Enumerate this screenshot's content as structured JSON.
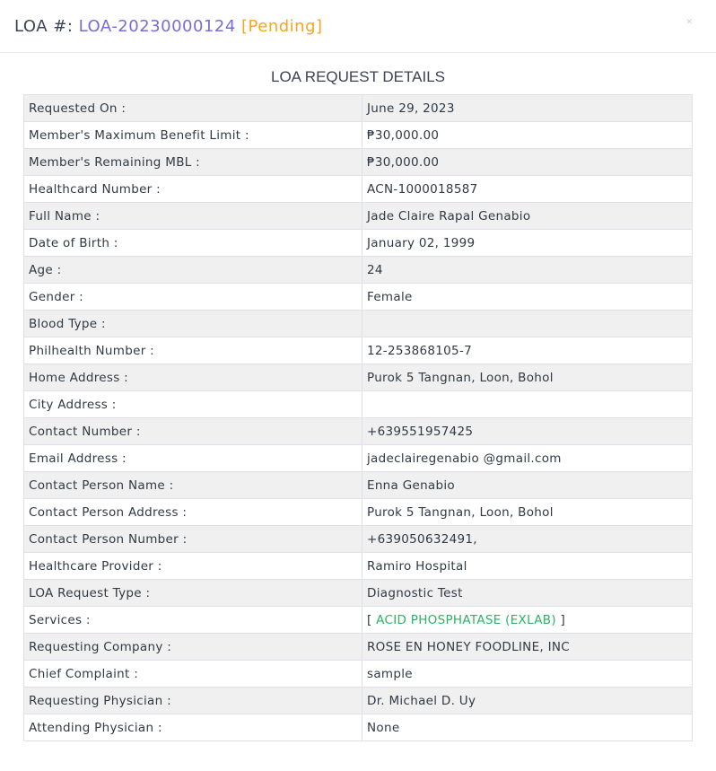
{
  "header": {
    "prefix": "LOA #:",
    "loa_number": "LOA-20230000124",
    "status": "[Pending]"
  },
  "section_title": "LOA REQUEST DETAILS",
  "rows": [
    {
      "label": "Requested On :",
      "value": "June 29, 2023"
    },
    {
      "label": "Member's Maximum Benefit Limit :",
      "value": "₱30,000.00"
    },
    {
      "label": "Member's Remaining MBL :",
      "value": "₱30,000.00"
    },
    {
      "label": "Healthcard Number :",
      "value": "ACN-1000018587"
    },
    {
      "label": "Full Name :",
      "value": "Jade Claire Rapal Genabio"
    },
    {
      "label": "Date of Birth :",
      "value": "January 02, 1999"
    },
    {
      "label": "Age :",
      "value": "24"
    },
    {
      "label": "Gender :",
      "value": "Female"
    },
    {
      "label": "Blood Type :",
      "value": ""
    },
    {
      "label": "Philhealth Number :",
      "value": "12-253868105-7"
    },
    {
      "label": "Home Address :",
      "value": "Purok 5 Tangnan, Loon, Bohol"
    },
    {
      "label": "City Address :",
      "value": ""
    },
    {
      "label": "Contact Number :",
      "value": "+639551957425"
    },
    {
      "label": "Email Address :",
      "value": "jadeclairegenabio @gmail.com"
    },
    {
      "label": "Contact Person Name :",
      "value": "Enna Genabio"
    },
    {
      "label": "Contact Person Address :",
      "value": "Purok 5 Tangnan, Loon, Bohol"
    },
    {
      "label": "Contact Person Number :",
      "value": "+639050632491,"
    },
    {
      "label": "Healthcare Provider :",
      "value": "Ramiro Hospital"
    },
    {
      "label": "LOA Request Type :",
      "value": "Diagnostic Test"
    },
    {
      "label": "Services :",
      "value_prefix": "[ ",
      "service": "ACID PHOSPHATASE (EXLAB)",
      "value_suffix": " ]"
    },
    {
      "label": "Requesting Company :",
      "value": "ROSE EN HONEY FOODLINE, INC"
    },
    {
      "label": "Chief Complaint :",
      "value": "sample"
    },
    {
      "label": "Requesting Physician :",
      "value": "Dr. Michael D. Uy"
    },
    {
      "label": "Attending Physician :",
      "value": "None"
    }
  ],
  "colors": {
    "loa_number": "#7b6bd6",
    "status_pending": "#f5a623",
    "service": "#28b463"
  }
}
